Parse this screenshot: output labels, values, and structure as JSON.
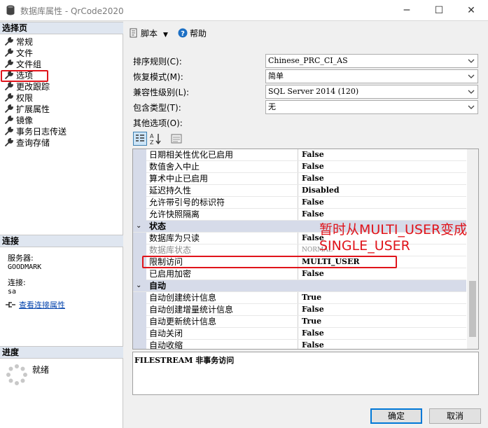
{
  "window": {
    "title": "数据库属性 - QrCode2020",
    "min_glyph": "─",
    "max_glyph": "☐",
    "close_glyph": "✕"
  },
  "sidebar": {
    "select_page_header": "选择页",
    "items": [
      {
        "label": "常规",
        "icon": "wrench-icon"
      },
      {
        "label": "文件",
        "icon": "wrench-icon"
      },
      {
        "label": "文件组",
        "icon": "wrench-icon"
      },
      {
        "label": "选项",
        "icon": "wrench-icon",
        "selected": true
      },
      {
        "label": "更改跟踪",
        "icon": "wrench-icon"
      },
      {
        "label": "权限",
        "icon": "wrench-icon"
      },
      {
        "label": "扩展属性",
        "icon": "wrench-icon"
      },
      {
        "label": "镜像",
        "icon": "wrench-icon"
      },
      {
        "label": "事务日志传送",
        "icon": "wrench-icon"
      },
      {
        "label": "查询存储",
        "icon": "wrench-icon"
      }
    ],
    "connection_header": "连接",
    "server_label": "服务器:",
    "server_value": "GOODMARK",
    "connection_label": "连接:",
    "connection_value": "sa",
    "view_connection_link": "查看连接属性",
    "progress_header": "进度",
    "progress_status": "就绪"
  },
  "toolbar": {
    "script_label": "脚本",
    "help_label": "帮助"
  },
  "properties": {
    "collation_label": "排序规则(C):",
    "collation_value": "Chinese_PRC_CI_AS",
    "recovery_label": "恢复模式(M):",
    "recovery_value": "简单",
    "compat_label": "兼容性级别(L):",
    "compat_value": "SQL Server 2014 (120)",
    "containment_label": "包含类型(T):",
    "containment_value": "无",
    "other_options_label": "其他选项(O):"
  },
  "grid": {
    "rows": [
      {
        "name": "日期相关性优化已启用",
        "value": "False"
      },
      {
        "name": "数值舍入中止",
        "value": "False"
      },
      {
        "name": "算术中止已启用",
        "value": "False"
      },
      {
        "name": "延迟持久性",
        "value": "Disabled"
      },
      {
        "name": "允许带引号的标识符",
        "value": "False"
      },
      {
        "name": "允许快照隔离",
        "value": "False"
      },
      {
        "category": "状态",
        "collapse_glyph": "⌄"
      },
      {
        "name": "数据库为只读",
        "value": "False"
      },
      {
        "name": "数据库状态",
        "value": "NORMAL",
        "disabled": true
      },
      {
        "name": "限制访问",
        "value": "MULTI_USER"
      },
      {
        "name": "已启用加密",
        "value": "False"
      },
      {
        "category": "自动",
        "collapse_glyph": "⌄"
      },
      {
        "name": "自动创建统计信息",
        "value": "True"
      },
      {
        "name": "自动创建增量统计信息",
        "value": "False"
      },
      {
        "name": "自动更新统计信息",
        "value": "True"
      },
      {
        "name": "自动关闭",
        "value": "False"
      },
      {
        "name": "自动收缩",
        "value": "False"
      }
    ]
  },
  "description": "FILESTREAM 非事务访问",
  "annotation": {
    "line1": "暂时从MULTI_USER变成",
    "line2": "SINGLE_USER",
    "color": "#e0141b"
  },
  "buttons": {
    "ok": "确定",
    "cancel": "取消"
  },
  "colors": {
    "accent": "#0078d7",
    "highlight": "#e0141b",
    "category_band": "#d6dbe9"
  }
}
